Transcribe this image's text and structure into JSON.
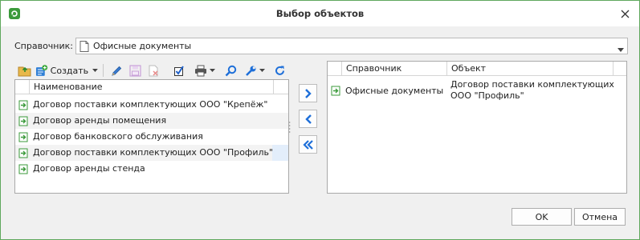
{
  "window": {
    "title": "Выбор объектов"
  },
  "reference": {
    "label": "Справочник:",
    "value": "Офисные документы"
  },
  "toolbar": {
    "create_label": "Создать"
  },
  "left_grid": {
    "column": "Наименование",
    "rows": [
      "Договор поставки комплектующих ООО \"Крепёж\"",
      "Договор аренды помещения",
      "Договор банковского обслуживания",
      "Договор поставки комплектующих ООО \"Профиль\"",
      "Договор аренды стенда"
    ]
  },
  "right_grid": {
    "columns": [
      "Справочник",
      "Объект"
    ],
    "rows": [
      {
        "reference": "Офисные документы",
        "object": "Договор поставки комплектующих ООО \"Профиль\""
      }
    ]
  },
  "buttons": {
    "ok": "OK",
    "cancel": "Отмена"
  },
  "colors": {
    "accent_blue": "#1e6fd9",
    "window_border": "#5fa85d",
    "doc_green": "#3a9a3a"
  }
}
